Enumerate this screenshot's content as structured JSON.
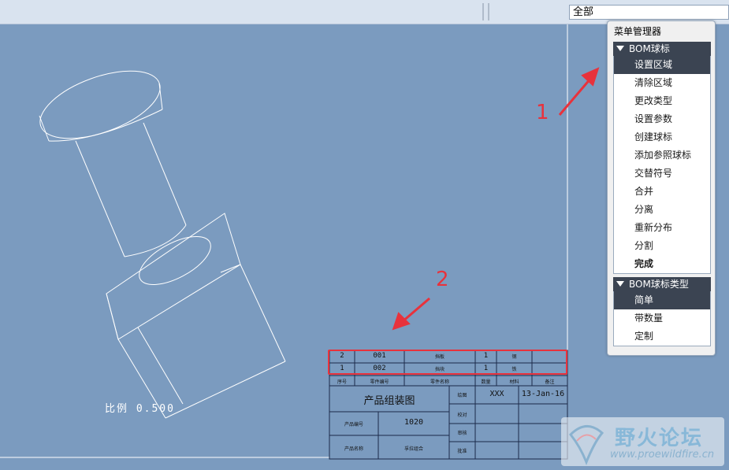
{
  "toolbar": {
    "filter_value": "全部"
  },
  "menu": {
    "title": "菜单管理器",
    "groups": [
      {
        "label": "BOM球标",
        "items": [
          "设置区域",
          "清除区域",
          "更改类型",
          "设置参数",
          "创建球标",
          "添加参照球标",
          "交替符号",
          "合并",
          "分离",
          "重新分布",
          "分割",
          "完成"
        ],
        "selected_index": 0
      },
      {
        "label": "BOM球标类型",
        "items": [
          "简单",
          "带数量",
          "定制"
        ],
        "selected_index": 0
      }
    ]
  },
  "annotations": {
    "label_1": "1",
    "label_2": "2"
  },
  "drawing": {
    "scale_text": "比例 0.500",
    "bom_rows": [
      [
        "2",
        "001",
        "挡板",
        "1",
        "钢",
        ""
      ],
      [
        "1",
        "002",
        "挡块",
        "1",
        "铁",
        ""
      ]
    ],
    "bom_header": [
      "序号",
      "零件编号",
      "零件名称",
      "数量",
      "材料",
      "备注"
    ],
    "title_block": {
      "name": "产品组装图",
      "drawn_by": "XXX",
      "date": "13-Jan-16",
      "product_no_label": "产品编号",
      "product_no": "1020",
      "product_name_label": "产品名称",
      "product_name": "孚拉组合",
      "designer_label": "绘图",
      "check_label": "校对",
      "review_label": "审核",
      "approve_label": "批准"
    }
  },
  "watermark": {
    "name": "野火论坛",
    "url": "www.proewildfire.cn"
  },
  "colors": {
    "background": "#7b9bbf",
    "highlight": "#e8323c",
    "menu_header": "#3b4452"
  }
}
